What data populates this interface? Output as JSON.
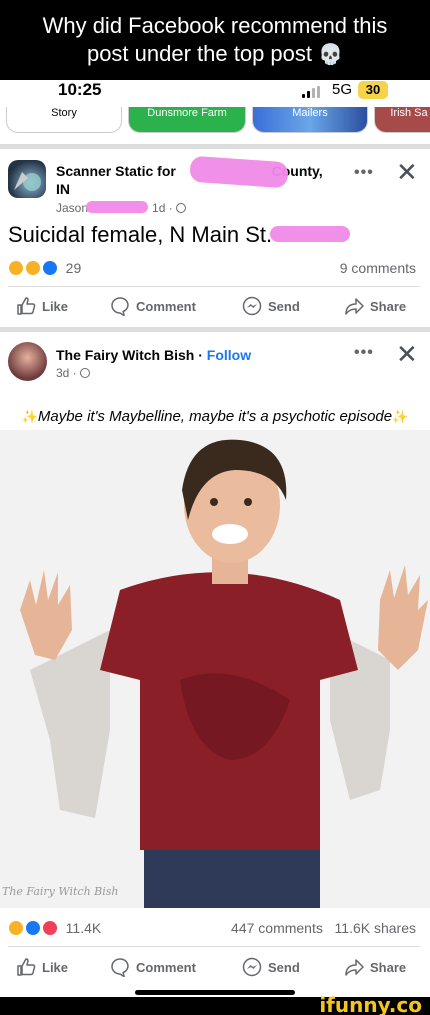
{
  "caption": {
    "line1": "Why did Facebook recommend this",
    "line2": "post under the top post",
    "skull_emoji": "💀"
  },
  "status_bar": {
    "time": "10:25",
    "network": "5G",
    "battery": "30"
  },
  "stories": [
    {
      "label": "Story",
      "color": "#ffffff"
    },
    {
      "label": "Dunsmore Farm",
      "color": "#2bb24c"
    },
    {
      "label": "Mailers",
      "color": "#3b6fd8"
    },
    {
      "label": "Irish Sa",
      "color": "#a64a4a"
    }
  ],
  "post1": {
    "page_name": "Scanner Static for",
    "page_name_suffix": "County,",
    "page_name_line2": "IN",
    "author": "Jason",
    "time": "· 1d ·",
    "text": "Suicidal female, N Main St.",
    "reaction_count": "29",
    "comments": "9 comments"
  },
  "post2": {
    "page_name": "The Fairy Witch Bish",
    "dot": "·",
    "follow_label": "Follow",
    "time": "3d ·",
    "text": "Maybe it's Maybelline, maybe it's a psychotic episode",
    "sparkle": "✨",
    "watermark": "The Fairy Witch Bish",
    "reaction_count": "11.4K",
    "comments": "447 comments",
    "shares": "11.6K shares"
  },
  "actions": {
    "like": "Like",
    "comment": "Comment",
    "send": "Send",
    "share": "Share"
  },
  "icons": {
    "more": "•••",
    "close": "✕",
    "globe": "globe-icon"
  },
  "watermark_site": "ifunny.co",
  "colors": {
    "follow": "#1877f2",
    "redaction": "#f08ae8",
    "like_blue": "#1877f2",
    "love_red": "#f33e58",
    "haha_yellow": "#f7b125"
  }
}
